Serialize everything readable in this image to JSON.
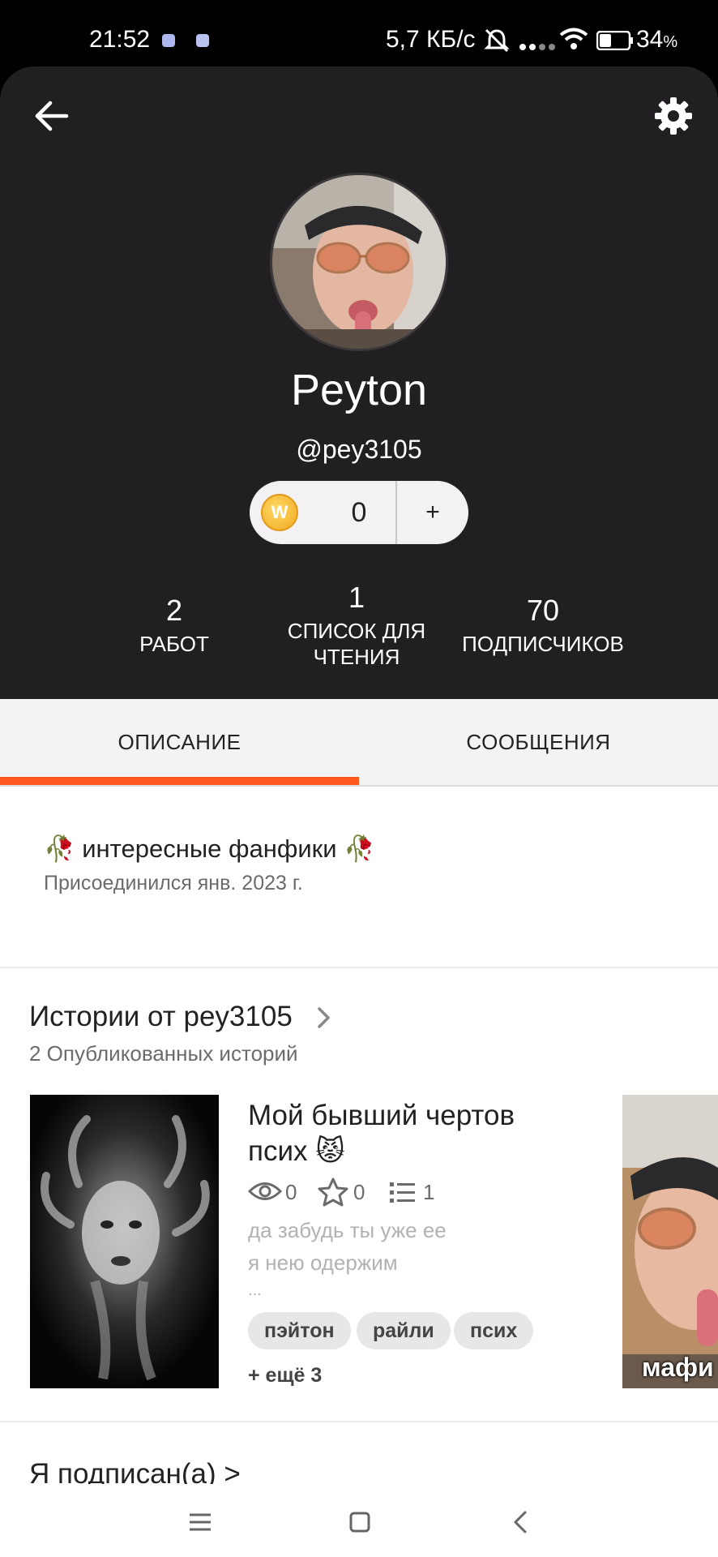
{
  "status_bar": {
    "time": "21:52",
    "network_speed": "5,7 КБ/с",
    "battery": "34",
    "battery_unit": "%"
  },
  "profile": {
    "name": "Peyton",
    "handle": "@pey3105",
    "coins": "0",
    "coins_add": "+",
    "coin_icon_letter": "W"
  },
  "stats": {
    "works": {
      "value": "2",
      "label": "РАБОТ"
    },
    "reading_lists": {
      "value": "1",
      "label_line1": "СПИСОК ДЛЯ",
      "label_line2": "ЧТЕНИЯ"
    },
    "followers": {
      "value": "70",
      "label": "ПОДПИСЧИКОВ"
    }
  },
  "tabs": {
    "about": "ОПИСАНИЕ",
    "messages": "СООБЩЕНИЯ",
    "active": "about"
  },
  "about": {
    "description": "🥀 интересные фанфики 🥀",
    "joined": "Присоединился янв. 2023 г."
  },
  "stories": {
    "title": "Истории от pey3105",
    "count": "2 Опубликованных историй",
    "items": [
      {
        "title": "Мой бывший чертов псих 😾",
        "views": "0",
        "votes": "0",
        "parts": "1",
        "desc_line1": "да забудь ты уже ее",
        "desc_line2": "я нею одержим",
        "desc_line3": "...",
        "tags": [
          "пэйтон",
          "райли",
          "псих"
        ],
        "more_tags": "+ ещё 3"
      },
      {
        "cover_text": "мафи"
      }
    ]
  },
  "following": {
    "title": "Я подписан(а) >"
  },
  "colors": {
    "accent": "#ff5a1f",
    "header_bg": "#221f22"
  }
}
